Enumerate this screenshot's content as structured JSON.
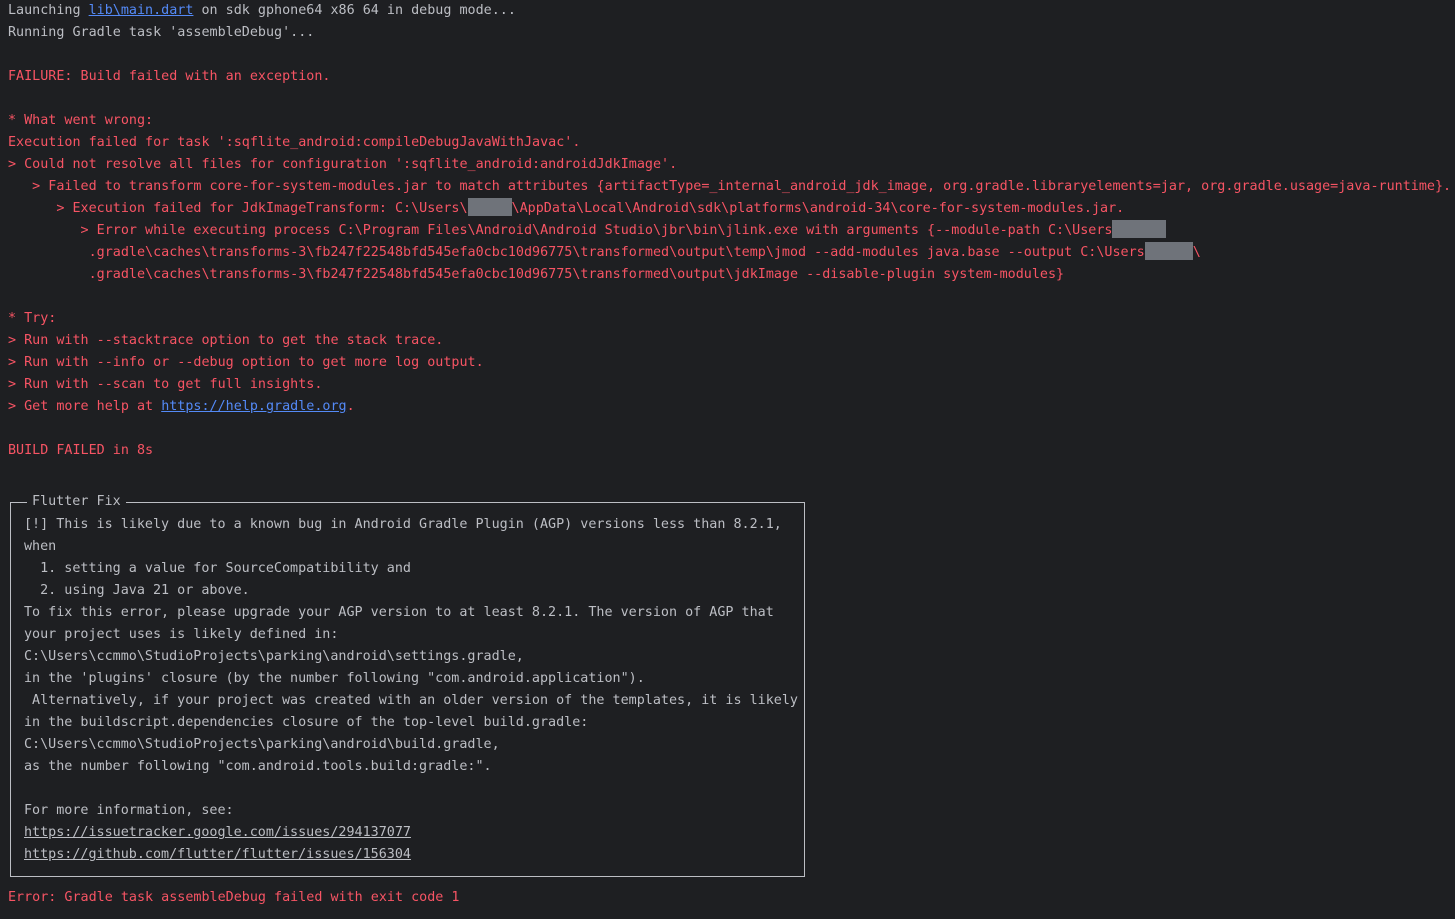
{
  "header": {
    "launching_prefix": "Launching ",
    "launching_file": "lib\\main.dart",
    "launching_suffix": " on sdk gphone64 x86 64 in debug mode...",
    "running_gradle": "Running Gradle task 'assembleDebug'..."
  },
  "failure": {
    "title": "FAILURE: Build failed with an exception.",
    "what_went_wrong": "* What went wrong:",
    "execution_failed": "Execution failed for task ':sqflite_android:compileDebugJavaWithJavac'.",
    "could_not_resolve": "> Could not resolve all files for configuration ':sqflite_android:androidJdkImage'.",
    "failed_transform": "   > Failed to transform core-for-system-modules.jar to match attributes {artifactType=_internal_android_jdk_image, org.gradle.libraryelements=jar, org.gradle.usage=java-runtime}.",
    "jdk_transform_prefix": "      > Execution failed for JdkImageTransform: C:\\Users\\",
    "jdk_transform_suffix": "\\AppData\\Local\\Android\\sdk\\platforms\\android-34\\core-for-system-modules.jar.",
    "error_process_prefix": "         > Error while executing process C:\\Program Files\\Android\\Android Studio\\jbr\\bin\\jlink.exe with arguments {--module-path C:\\Users",
    "jmod_prefix": "          .gradle\\caches\\transforms-3\\fb247f22548bfd545efa0cbc10d96775\\transformed\\output\\temp\\jmod --add-modules java.base --output C:\\Users",
    "jmod_suffix": "\\",
    "jdkimage_line": "          .gradle\\caches\\transforms-3\\fb247f22548bfd545efa0cbc10d96775\\transformed\\output\\jdkImage --disable-plugin system-modules}"
  },
  "try_section": {
    "title": "* Try:",
    "stacktrace": "> Run with --stacktrace option to get the stack trace.",
    "info": "> Run with --info or --debug option to get more log output.",
    "scan": "> Run with --scan to get full insights.",
    "help_prefix": "> Get more help at ",
    "help_link": "https://help.gradle.org",
    "help_suffix": "."
  },
  "build_failed": "BUILD FAILED in 8s",
  "flutter_fix": {
    "title": "Flutter Fix",
    "lines": [
      "[!] This is likely due to a known bug in Android Gradle Plugin (AGP) versions less than 8.2.1,",
      "when",
      "  1. setting a value for SourceCompatibility and",
      "  2. using Java 21 or above.",
      "To fix this error, please upgrade your AGP version to at least 8.2.1. The version of AGP that",
      "your project uses is likely defined in:",
      "C:\\Users\\ccmmo\\StudioProjects\\parking\\android\\settings.gradle,",
      "in the 'plugins' closure (by the number following \"com.android.application\").",
      " Alternatively, if your project was created with an older version of the templates, it is likely",
      "in the buildscript.dependencies closure of the top-level build.gradle:",
      "C:\\Users\\ccmmo\\StudioProjects\\parking\\android\\build.gradle,",
      "as the number following \"com.android.tools.build:gradle:\".",
      "",
      "For more information, see:"
    ],
    "links": [
      "https://issuetracker.google.com/issues/294137077",
      "https://github.com/flutter/flutter/issues/156304"
    ]
  },
  "final_error": "Error: Gradle task assembleDebug failed with exit code 1"
}
